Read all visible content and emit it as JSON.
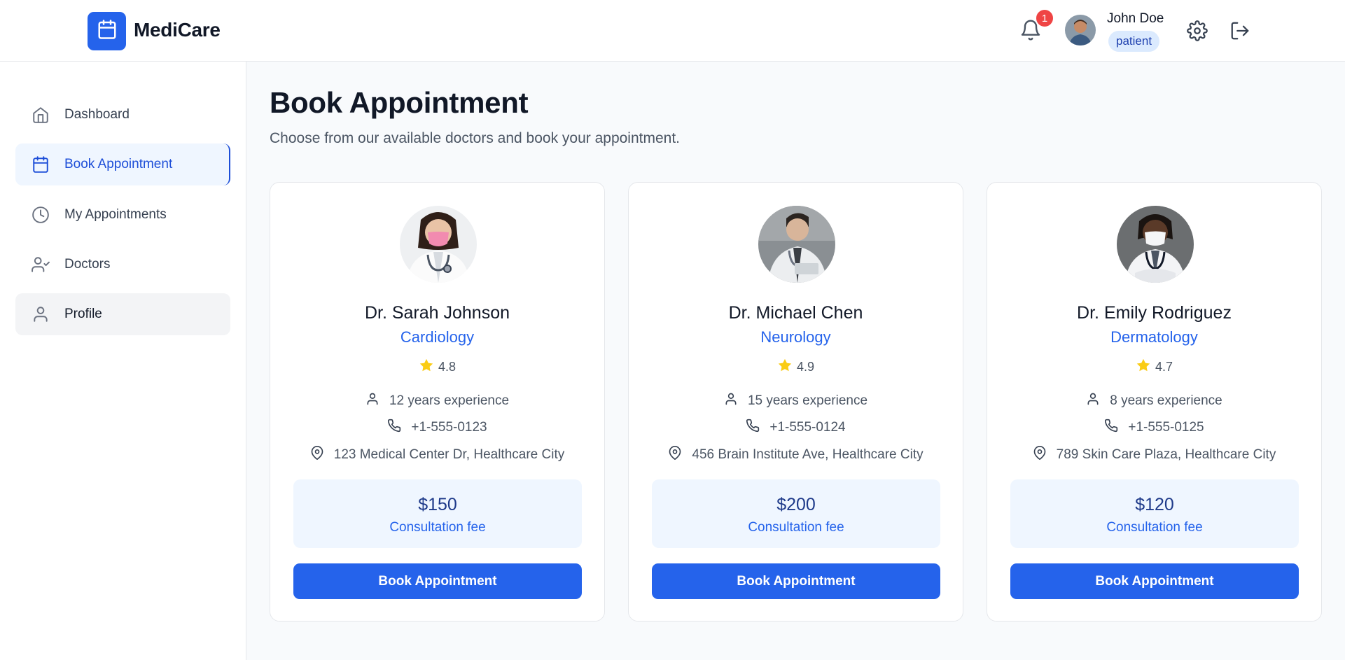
{
  "header": {
    "brand": "MediCare",
    "notification_count": "1",
    "user_name": "John Doe",
    "user_role": "patient",
    "icons": [
      "calendar-icon",
      "bell-icon",
      "gear-icon",
      "logout-icon"
    ]
  },
  "sidebar": {
    "items": [
      {
        "label": "Dashboard",
        "icon": "home-icon"
      },
      {
        "label": "Book Appointment",
        "icon": "calendar-icon"
      },
      {
        "label": "My Appointments",
        "icon": "clock-icon"
      },
      {
        "label": "Doctors",
        "icon": "user-check-icon"
      },
      {
        "label": "Profile",
        "icon": "user-icon"
      }
    ]
  },
  "main": {
    "title": "Book Appointment",
    "subtitle": "Choose from our available doctors and book your appointment.",
    "doctors": [
      {
        "name": "Dr. Sarah Johnson",
        "specialty": "Cardiology",
        "rating": "4.8",
        "experience": "12 years experience",
        "phone": "+1-555-0123",
        "address": "123 Medical Center Dr, Healthcare City",
        "fee": "$150",
        "fee_label": "Consultation fee",
        "button": "Book Appointment"
      },
      {
        "name": "Dr. Michael Chen",
        "specialty": "Neurology",
        "rating": "4.9",
        "experience": "15 years experience",
        "phone": "+1-555-0124",
        "address": "456 Brain Institute Ave, Healthcare City",
        "fee": "$200",
        "fee_label": "Consultation fee",
        "button": "Book Appointment"
      },
      {
        "name": "Dr. Emily Rodriguez",
        "specialty": "Dermatology",
        "rating": "4.7",
        "experience": "8 years experience",
        "phone": "+1-555-0125",
        "address": "789 Skin Care Plaza, Healthcare City",
        "fee": "$120",
        "fee_label": "Consultation fee",
        "button": "Book Appointment"
      }
    ]
  },
  "colors": {
    "primary": "#2563eb",
    "badge": "#ef4444",
    "star": "#facc15",
    "fee_bg": "#eff6ff"
  }
}
